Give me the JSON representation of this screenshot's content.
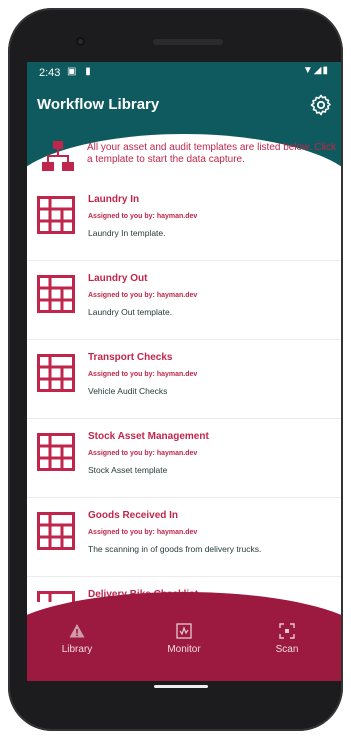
{
  "status": {
    "time": "2:43",
    "left_icons": "▣ ▮",
    "right_icons": "▼◢▮"
  },
  "appbar": {
    "title": "Workflow Library"
  },
  "info": {
    "text": "All your asset and audit templates are listed below. Click a template to start the data capture."
  },
  "items": [
    {
      "name": "Laundry In",
      "assigned": "Assigned to you by: hayman.dev",
      "desc": "Laundry In template."
    },
    {
      "name": "Laundry Out",
      "assigned": "Assigned to you by: hayman.dev",
      "desc": "Laundry Out template."
    },
    {
      "name": "Transport Checks",
      "assigned": "Assigned to you by: hayman.dev",
      "desc": "Vehicle Audit Checks"
    },
    {
      "name": "Stock Asset Management",
      "assigned": "Assigned to you by: hayman.dev",
      "desc": "Stock Asset template"
    },
    {
      "name": "Goods Received In",
      "assigned": "Assigned to you by: hayman.dev",
      "desc": "The scanning in of goods from delivery trucks."
    },
    {
      "name": "Delivery Bike Checklist",
      "assigned": "",
      "desc": ""
    }
  ],
  "nav": [
    {
      "label": "Library",
      "icon": "warning-triangle-icon"
    },
    {
      "label": "Monitor",
      "icon": "monitor-icon"
    },
    {
      "label": "Scan",
      "icon": "scan-icon"
    }
  ],
  "colors": {
    "teal": "#0f5a5f",
    "crimson": "#c0264b",
    "bottom": "#9c1a3f"
  }
}
